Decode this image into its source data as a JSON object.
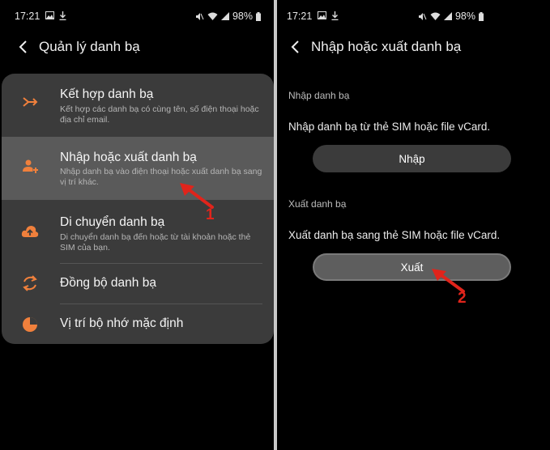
{
  "left_screen": {
    "status": {
      "time": "17:21",
      "battery": "98%"
    },
    "header": {
      "title": "Quản lý danh bạ"
    },
    "menu": [
      {
        "title": "Kết hợp danh bạ",
        "desc": "Kết hợp các danh bạ có cùng tên, số điện thoại hoặc địa chỉ email.",
        "icon": "merge-icon"
      },
      {
        "title": "Nhập hoặc xuất danh bạ",
        "desc": "Nhập danh bạ vào điện thoại hoặc xuất danh bạ sang vị trí khác.",
        "icon": "import-export-icon"
      },
      {
        "title": "Di chuyển danh bạ",
        "desc": "Di chuyển danh bạ đến hoặc từ tài khoản hoặc thẻ SIM của bạn.",
        "icon": "cloud-upload-icon"
      },
      {
        "title": "Đồng bộ danh bạ",
        "icon": "sync-icon"
      },
      {
        "title": "Vị trí bộ nhớ mặc định",
        "icon": "storage-pie-icon"
      }
    ],
    "annotation": "1"
  },
  "right_screen": {
    "status": {
      "time": "17:21",
      "battery": "98%"
    },
    "header": {
      "title": "Nhập hoặc xuất danh bạ"
    },
    "import_section": {
      "label": "Nhập danh bạ",
      "text": "Nhập danh bạ từ thẻ SIM hoặc file vCard.",
      "button": "Nhập"
    },
    "export_section": {
      "label": "Xuất danh bạ",
      "text": "Xuất danh bạ sang thẻ SIM hoặc file vCard.",
      "button": "Xuất"
    },
    "annotation": "2"
  },
  "colors": {
    "accent": "#f0803c",
    "card": "#3b3b3b",
    "selected": "#5a5a5a",
    "arrow": "#e0241b"
  }
}
